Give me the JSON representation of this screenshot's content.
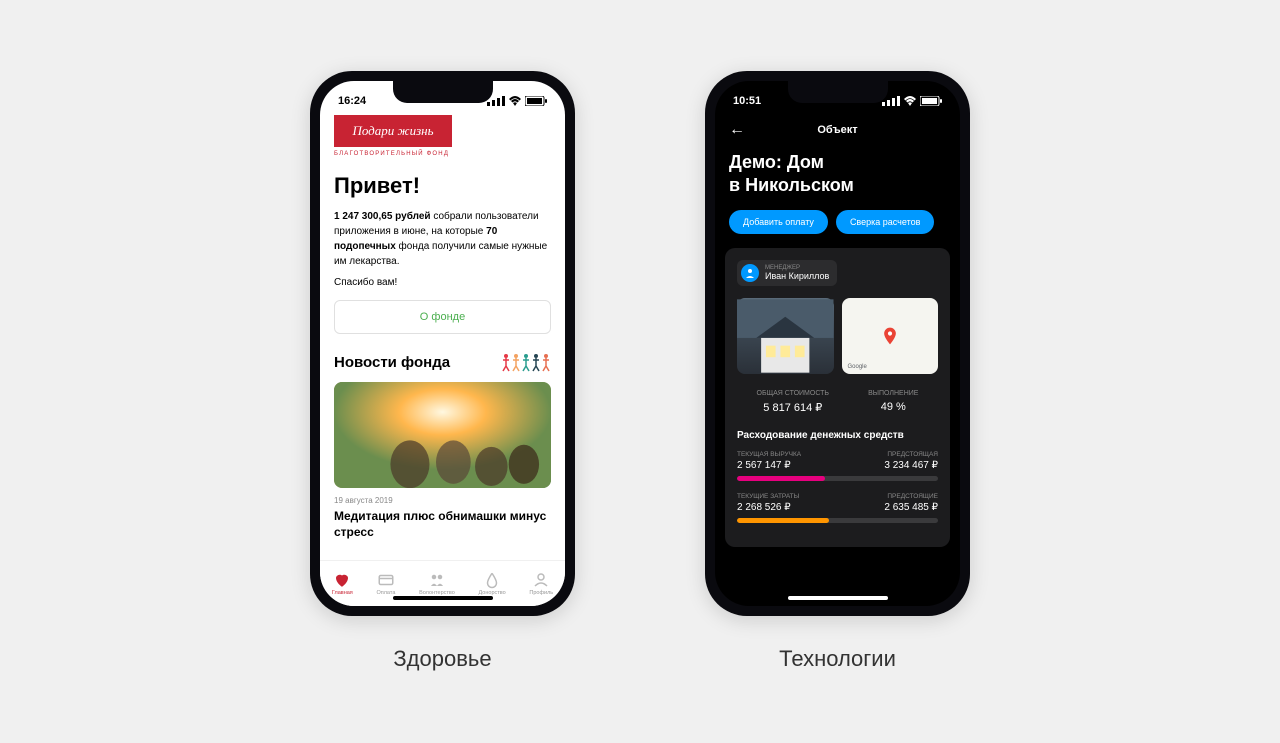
{
  "phone1": {
    "status_time": "16:24",
    "logo_text": "Подари жизнь",
    "logo_subtitle": "БЛАГОТВОРИТЕЛЬНЫЙ ФОНД",
    "greeting": "Привет!",
    "stat_amount": "1 247 300,65 рублей",
    "stat_text1": " собрали пользователи приложения в июне, на которые ",
    "stat_bold2": "70 подопечных",
    "stat_text2": " фонда получили самые нужные им лекарства.",
    "thanks": "Спасибо вам!",
    "about_btn": "О фонде",
    "news_title": "Новости фонда",
    "news_date": "19 августа 2019",
    "news_headline": "Медитация плюс обнимашки минус стресс",
    "tabs": [
      {
        "label": "Главная",
        "active": true
      },
      {
        "label": "Оплата",
        "active": false
      },
      {
        "label": "Волонтерство",
        "active": false
      },
      {
        "label": "Донорство",
        "active": false
      },
      {
        "label": "Профиль",
        "active": false
      }
    ],
    "caption": "Здоровье"
  },
  "phone2": {
    "status_time": "10:51",
    "nav_title": "Объект",
    "title_line1": "Демо: Дом",
    "title_line2": "в Никольском",
    "btn1": "Добавить оплату",
    "btn2": "Сверка расчетов",
    "manager_label": "МЕНЕДЖЕР",
    "manager_name": "Иван Кириллов",
    "map_attribution": "Google",
    "total_cost_label": "ОБЩАЯ СТОИМОСТЬ",
    "total_cost_value": "5 817 614 ₽",
    "completion_label": "ВЫПОЛНЕНИЕ",
    "completion_value": "49 %",
    "spending_title": "Расходование денежных средств",
    "revenue_current_label": "ТЕКУЩАЯ ВЫРУЧКА",
    "revenue_upcoming_label": "ПРЕДСТОЯЩАЯ",
    "revenue_current": "2 567 147 ₽",
    "revenue_upcoming": "3 234 467 ₽",
    "revenue_progress_pct": 44,
    "revenue_color": "#e6007e",
    "expense_current_label": "ТЕКУЩИЕ ЗАТРАТЫ",
    "expense_upcoming_label": "ПРЕДСТОЯЩИЕ",
    "expense_current": "2 268 526 ₽",
    "expense_upcoming": "2 635 485 ₽",
    "expense_progress_pct": 46,
    "expense_color": "#ff9500",
    "caption": "Технологии"
  }
}
